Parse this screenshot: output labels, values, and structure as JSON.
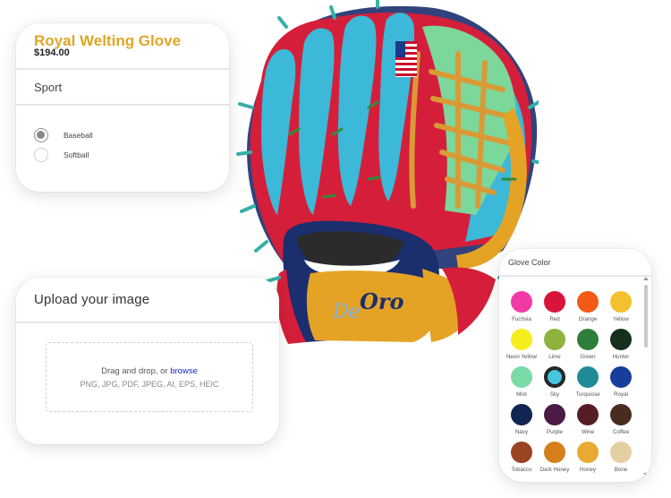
{
  "product": {
    "title": "Royal Welting Glove",
    "price": "$194.00",
    "section_label": "Sport",
    "options": [
      {
        "label": "Baseball",
        "selected": true
      },
      {
        "label": "Softball",
        "selected": false
      }
    ]
  },
  "upload": {
    "title": "Upload your image",
    "drop_text": "Drag and drop, or",
    "browse_text": "browse",
    "formats": "PNG, JPG, PDF, JPEG, AI, EPS, HEIC"
  },
  "glove_color": {
    "title": "Glove Color",
    "selected": "Sky",
    "swatches": [
      {
        "name": "Fuchsia",
        "color": "#f23aa6"
      },
      {
        "name": "Red",
        "color": "#d8143a"
      },
      {
        "name": "Orange",
        "color": "#f25a16"
      },
      {
        "name": "Yellow",
        "color": "#f5c02e"
      },
      {
        "name": "Neon Yellow",
        "color": "#f6ee1c"
      },
      {
        "name": "Lime",
        "color": "#8db33e"
      },
      {
        "name": "Green",
        "color": "#2f7d3b"
      },
      {
        "name": "Hunter",
        "color": "#15301c"
      },
      {
        "name": "Mint",
        "color": "#79dba6"
      },
      {
        "name": "Sky",
        "color": "#45c6de"
      },
      {
        "name": "Turquiose",
        "color": "#208b98"
      },
      {
        "name": "Royal",
        "color": "#173e9b"
      },
      {
        "name": "Navy",
        "color": "#122451"
      },
      {
        "name": "Purple",
        "color": "#4b1a45"
      },
      {
        "name": "Wine",
        "color": "#561d26"
      },
      {
        "name": "Coffee",
        "color": "#4a2b20"
      },
      {
        "name": "Tobacco",
        "color": "#9b4422"
      },
      {
        "name": "Dark Honey",
        "color": "#d47f1c"
      },
      {
        "name": "Honey",
        "color": "#e9aa33"
      },
      {
        "name": "Bone",
        "color": "#e4cfa4"
      }
    ]
  },
  "glove_preview": {
    "logo_text_1": "De",
    "logo_text_2": "Oro",
    "colors": {
      "red": "#d51f3a",
      "sky": "#3cb8d8",
      "mint": "#7cd79b",
      "gold": "#e5a325",
      "navy": "#1b2e6e",
      "lace": "#d99a36"
    }
  }
}
